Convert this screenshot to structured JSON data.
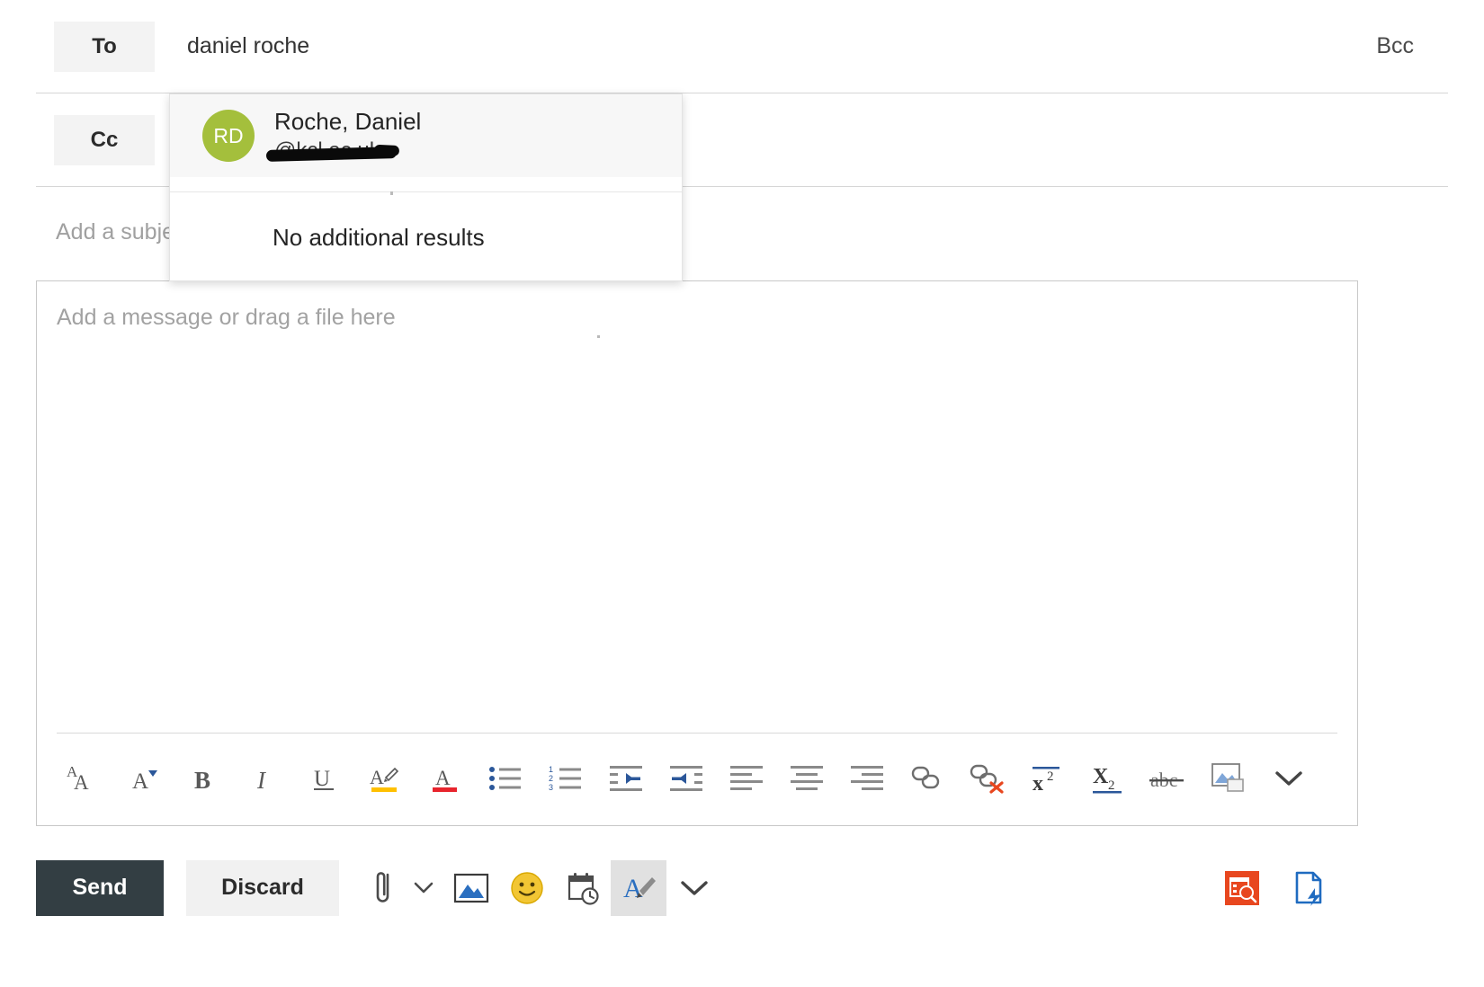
{
  "compose": {
    "to": {
      "label": "To",
      "value": "daniel roche",
      "placeholder": "To"
    },
    "cc": {
      "label": "Cc",
      "value": "",
      "placeholder": ""
    },
    "bcc_label": "Bcc",
    "subject": {
      "value": "",
      "placeholder": "Add a subject"
    },
    "body": {
      "value": "",
      "placeholder": "Add a message or drag a file here"
    }
  },
  "suggestions": {
    "items": [
      {
        "initials": "RD",
        "avatar_color": "#a4bf3c",
        "name": "Roche, Daniel",
        "email": "@kcl.ac.uk",
        "email_redacted": true
      }
    ],
    "no_results_label": "No additional results"
  },
  "format_toolbar": {
    "buttons": [
      {
        "name": "font-size-icon",
        "label": "Font size"
      },
      {
        "name": "font-color-picker-icon",
        "label": "Text styles"
      },
      {
        "name": "bold-icon",
        "label": "Bold"
      },
      {
        "name": "italic-icon",
        "label": "Italic"
      },
      {
        "name": "underline-icon",
        "label": "Underline"
      },
      {
        "name": "highlight-icon",
        "label": "Highlight"
      },
      {
        "name": "font-color-icon",
        "label": "Font color"
      },
      {
        "name": "bulleted-list-icon",
        "label": "Bulleted list"
      },
      {
        "name": "numbered-list-icon",
        "label": "Numbered list"
      },
      {
        "name": "decrease-indent-icon",
        "label": "Decrease indent"
      },
      {
        "name": "increase-indent-icon",
        "label": "Increase indent"
      },
      {
        "name": "align-left-icon",
        "label": "Align left"
      },
      {
        "name": "align-center-icon",
        "label": "Align center"
      },
      {
        "name": "align-right-icon",
        "label": "Align right"
      },
      {
        "name": "insert-link-icon",
        "label": "Insert link"
      },
      {
        "name": "remove-link-icon",
        "label": "Remove link"
      },
      {
        "name": "superscript-icon",
        "label": "Superscript"
      },
      {
        "name": "subscript-icon",
        "label": "Subscript"
      },
      {
        "name": "strikethrough-icon",
        "label": "Strikethrough"
      },
      {
        "name": "insert-picture-icon",
        "label": "Insert picture inline"
      },
      {
        "name": "more-formatting-options-icon",
        "label": "More options"
      }
    ]
  },
  "actions": {
    "send_label": "Send",
    "discard_label": "Discard",
    "buttons": [
      {
        "name": "attach-icon",
        "label": "Attach"
      },
      {
        "name": "attach-chevron-down-icon",
        "label": "Attach options"
      },
      {
        "name": "insert-picture-icon",
        "label": "Insert picture"
      },
      {
        "name": "emoji-icon",
        "label": "Emoji"
      },
      {
        "name": "schedule-poll-icon",
        "label": "Poll / meeting time"
      },
      {
        "name": "signature-icon",
        "label": "Signature"
      },
      {
        "name": "more-actions-chevron-down-icon",
        "label": "More options"
      }
    ],
    "right_buttons": [
      {
        "name": "find-time-icon",
        "label": "FindTime"
      },
      {
        "name": "quick-document-icon",
        "label": "Document add-in"
      }
    ]
  },
  "colors": {
    "send_button_bg": "#333e43",
    "accent_blue": "#2b579a",
    "highlight_yellow": "#ffc000",
    "font_color_red": "#e8242d",
    "findtime_orange": "#e8471f",
    "avatar_green": "#a4bf3c"
  }
}
